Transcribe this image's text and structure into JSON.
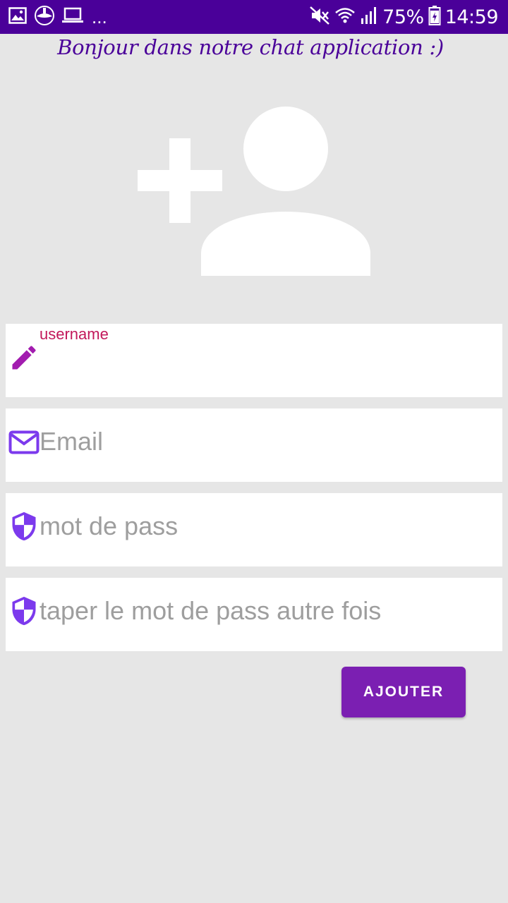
{
  "status_bar": {
    "battery": "75%",
    "time": "14:59",
    "overflow": "...",
    "icons_left": [
      "gallery-icon",
      "app-icon",
      "laptop-icon"
    ],
    "icons_right": [
      "mute-icon",
      "wifi-icon",
      "signal-icon",
      "battery-icon"
    ]
  },
  "greeting": "Bonjour dans notre chat application :)",
  "avatar": {
    "icon": "add-user-icon"
  },
  "form": {
    "username": {
      "label": "username",
      "value": "",
      "icon": "pencil-icon"
    },
    "email": {
      "placeholder": "Email",
      "icon": "mail-icon"
    },
    "password": {
      "placeholder": "mot de pass",
      "icon": "shield-icon"
    },
    "confirm": {
      "placeholder": "taper le mot de pass autre fois",
      "icon": "shield-icon"
    }
  },
  "submit_label": "AJOUTER",
  "colors": {
    "status_bar": "#4a0099",
    "accent": "#7b1fb2",
    "icon_purple": "#7c3aed",
    "pencil": "#a21caf",
    "label": "#c2185b",
    "background": "#e6e6e6"
  }
}
